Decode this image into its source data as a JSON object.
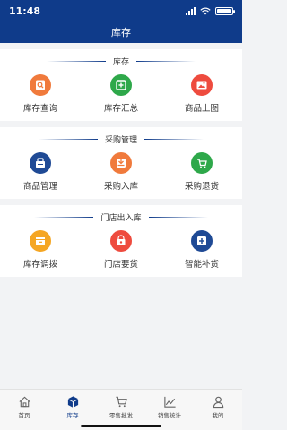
{
  "status": {
    "time": "11:48"
  },
  "header": {
    "title": "库存"
  },
  "sections": [
    {
      "title": "库存",
      "items": [
        {
          "label": "库存查询",
          "icon": "search-document-icon",
          "color": "#f07a3c"
        },
        {
          "label": "库存汇总",
          "icon": "add-square-icon",
          "color": "#2ea84a"
        },
        {
          "label": "商品上图",
          "icon": "image-upload-icon",
          "color": "#ee4b3e"
        }
      ]
    },
    {
      "title": "采购管理",
      "items": [
        {
          "label": "商品管理",
          "icon": "product-box-icon",
          "color": "#1f4a95"
        },
        {
          "label": "采购入库",
          "icon": "inbox-in-icon",
          "color": "#f07a3c"
        },
        {
          "label": "采购退货",
          "icon": "cart-return-icon",
          "color": "#2ea84a"
        }
      ]
    },
    {
      "title": "门店出入库",
      "items": [
        {
          "label": "库存调拨",
          "icon": "transfer-icon",
          "color": "#f5a623"
        },
        {
          "label": "门店要货",
          "icon": "store-request-icon",
          "color": "#ee4b3e"
        },
        {
          "label": "智能补货",
          "icon": "smart-replenish-icon",
          "color": "#1f4a95"
        }
      ]
    }
  ],
  "tabbar": {
    "tabs": [
      {
        "label": "首页",
        "icon": "home-icon",
        "active": false
      },
      {
        "label": "库存",
        "icon": "inventory-cube-icon",
        "active": true
      },
      {
        "label": "零售批发",
        "icon": "shopping-cart-icon",
        "active": false
      },
      {
        "label": "销售统计",
        "icon": "line-chart-icon",
        "active": false
      },
      {
        "label": "我的",
        "icon": "user-icon",
        "active": false
      }
    ],
    "active_color": "#0f3b8a"
  }
}
